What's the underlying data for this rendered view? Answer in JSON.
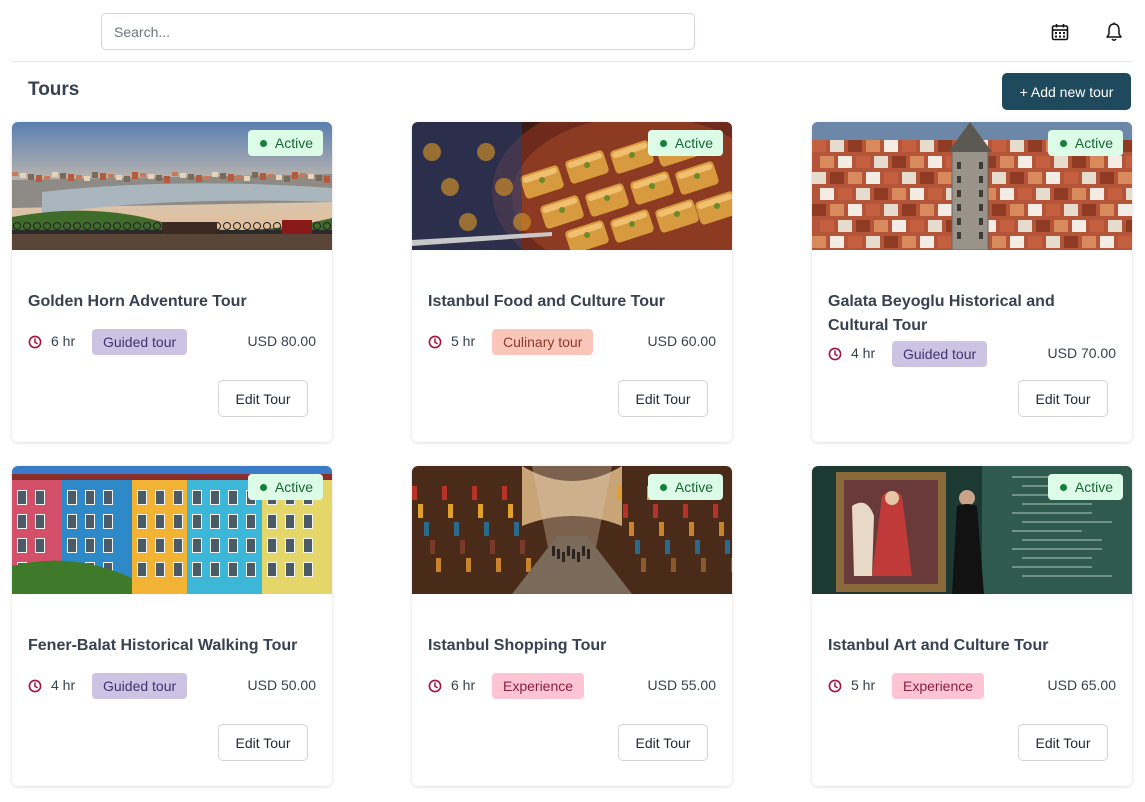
{
  "search": {
    "placeholder": "Search..."
  },
  "header": {
    "title": "Tours",
    "add_label": "+ Add new tour"
  },
  "colors": {
    "primary": "#1f4a5e",
    "active_bg": "#dcfce7",
    "active_text": "#166534",
    "guided_bg": "#cdc3e3",
    "guided_text": "#3f3470",
    "culinary_bg": "#fac6b9",
    "culinary_text": "#8a3a2a",
    "experience_bg": "#fcc4d4",
    "experience_text": "#8a1f3d",
    "clock": "#a4123f"
  },
  "tours": [
    {
      "title": "Golden Horn Adventure Tour",
      "status": "Active",
      "duration": "6 hr",
      "category": "Guided tour",
      "price": "USD 80.00",
      "edit_label": "Edit Tour",
      "image": "golden-horn-panorama"
    },
    {
      "title": "Istanbul Food and Culture Tour",
      "status": "Active",
      "duration": "5 hr",
      "category": "Culinary tour",
      "price": "USD 60.00",
      "edit_label": "Edit Tour",
      "image": "baklava-tray"
    },
    {
      "title": "Galata Beyoglu Historical and Cultural Tour",
      "status": "Active",
      "duration": "4 hr",
      "category": "Guided tour",
      "price": "USD 70.00",
      "edit_label": "Edit Tour",
      "image": "galata-tower-aerial"
    },
    {
      "title": "Fener-Balat Historical Walking Tour",
      "status": "Active",
      "duration": "4 hr",
      "category": "Guided tour",
      "price": "USD 50.00",
      "edit_label": "Edit Tour",
      "image": "colorful-houses"
    },
    {
      "title": "Istanbul Shopping Tour",
      "status": "Active",
      "duration": "6 hr",
      "category": "Experience",
      "price": "USD 55.00",
      "edit_label": "Edit Tour",
      "image": "grand-bazaar"
    },
    {
      "title": "Istanbul Art and Culture Tour",
      "status": "Active",
      "duration": "5 hr",
      "category": "Experience",
      "price": "USD 65.00",
      "edit_label": "Edit Tour",
      "image": "museum-painting"
    }
  ]
}
